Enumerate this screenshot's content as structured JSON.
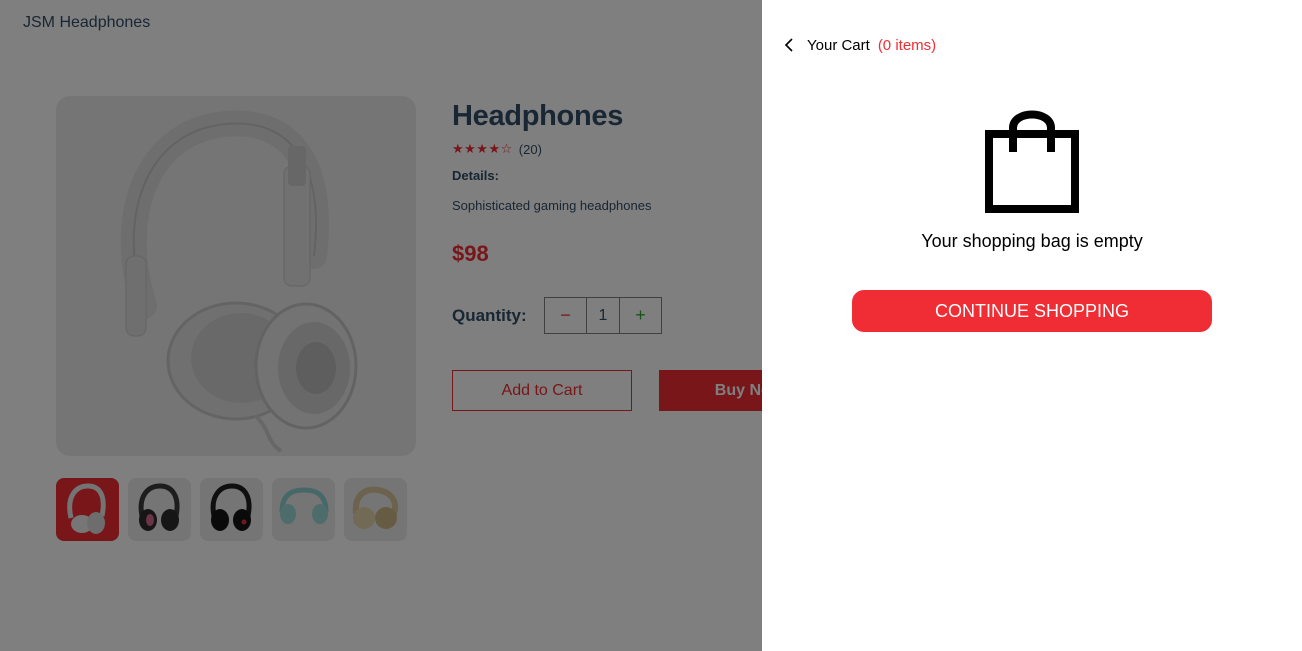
{
  "navbar": {
    "brand": "JSM Headphones"
  },
  "product": {
    "title": "Headphones",
    "rating_stars": "★★★★☆",
    "rating_value": 4,
    "review_count": "(20)",
    "details_label": "Details:",
    "details_text": "Sophisticated gaming headphones",
    "price": "$98",
    "quantity_label": "Quantity:",
    "quantity_value": "1",
    "minus_symbol": "−",
    "plus_symbol": "+",
    "add_to_cart_label": "Add to Cart",
    "buy_now_label": "Buy Now",
    "thumbnails": [
      "white-headphones",
      "black-pink-headphones",
      "black-red-headphones",
      "teal-headphones",
      "beige-headphones"
    ],
    "selected_thumbnail": 0
  },
  "cart": {
    "title": "Your Cart",
    "count_text": "(0 items)",
    "empty_message": "Your shopping bag is empty",
    "continue_label": "CONTINUE SHOPPING"
  },
  "icons": {
    "back": "chevron-left-icon",
    "bag": "shopping-bag-icon"
  },
  "colors": {
    "accent": "#f02d34",
    "text_dark": "#324d67",
    "plus_green": "#31a831",
    "overlay": "rgba(0,0,0,0.5)"
  }
}
